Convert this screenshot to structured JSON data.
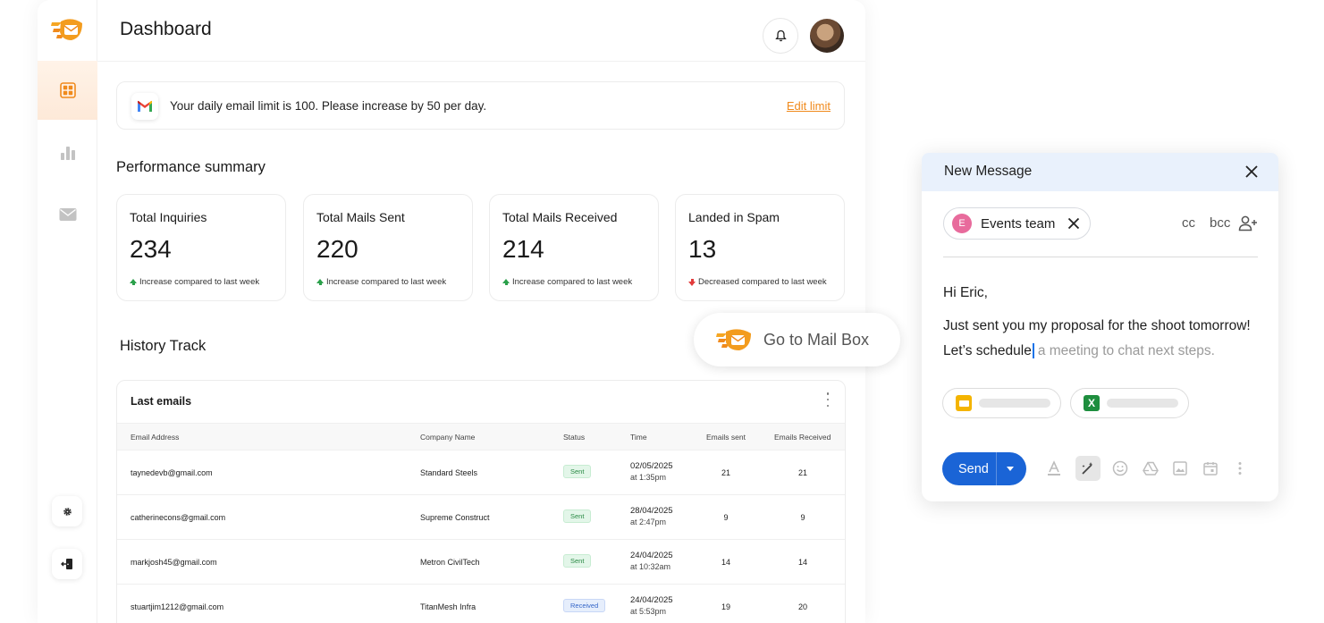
{
  "topbar": {
    "title": "Dashboard"
  },
  "sidebar": {
    "items": [
      {
        "name": "dashboard",
        "icon": "grid-icon",
        "active": true
      },
      {
        "name": "analytics",
        "icon": "bar-chart-icon",
        "active": false
      },
      {
        "name": "mail",
        "icon": "mail-icon",
        "active": false
      }
    ],
    "bottom": [
      {
        "name": "settings",
        "icon": "gear-icon"
      },
      {
        "name": "logout",
        "icon": "logout-icon"
      }
    ]
  },
  "limit": {
    "message": "Your daily email limit is 100. Please increase by 50 per day.",
    "edit_label": "Edit limit"
  },
  "summary": {
    "title": "Performance summary",
    "cards": [
      {
        "label": "Total Inquiries",
        "value": "234",
        "note": "Increase compared to last week",
        "trend": "up"
      },
      {
        "label": "Total Mails Sent",
        "value": "220",
        "note": "Increase compared to last week",
        "trend": "up"
      },
      {
        "label": "Total Mails Received",
        "value": "214",
        "note": "Increase compared to last week",
        "trend": "up"
      },
      {
        "label": "Landed in Spam",
        "value": "13",
        "note": "Decreased compared to last week",
        "trend": "down"
      }
    ]
  },
  "history": {
    "title": "History Track",
    "table_title": "Last emails",
    "columns": [
      "Email Address",
      "Company Name",
      "Status",
      "Time",
      "Emails sent",
      "Emails Received"
    ],
    "rows": [
      {
        "email": "taynedevb@gmail.com",
        "company": "Standard Steels",
        "status": "Sent",
        "date": "02/05/2025",
        "time": "at 1:35pm",
        "sent": "21",
        "received": "21"
      },
      {
        "email": "catherinecons@gmail.com",
        "company": "Supreme Construct",
        "status": "Sent",
        "date": "28/04/2025",
        "time": "at 2:47pm",
        "sent": "9",
        "received": "9"
      },
      {
        "email": "markjosh45@gmail.com",
        "company": "Metron CivilTech",
        "status": "Sent",
        "date": "24/04/2025",
        "time": "at 10:32am",
        "sent": "14",
        "received": "14"
      },
      {
        "email": "stuartjim1212@gmail.com",
        "company": "TitanMesh Infra",
        "status": "Received",
        "date": "24/04/2025",
        "time": "at 5:53pm",
        "sent": "19",
        "received": "20"
      }
    ]
  },
  "mailbox_button": {
    "label": "Go to Mail Box"
  },
  "composer": {
    "title": "New Message",
    "recipient": {
      "initial": "E",
      "name": "Events team"
    },
    "cc_label": "cc",
    "bcc_label": "bcc",
    "greeting": "Hi Eric,",
    "line1": "Just sent you my proposal for the shoot tomorrow!",
    "line2_typed": "Let’s schedule",
    "line2_suggestion": "a meeting to chat next steps.",
    "attachments": [
      {
        "type": "slides",
        "icon": "slides-icon",
        "color": "#f4b400"
      },
      {
        "type": "sheets",
        "icon": "excel-icon",
        "color": "#1e8e3e",
        "glyph": "X"
      }
    ],
    "send_label": "Send",
    "toolbar": [
      "text-format-icon",
      "magic-pen-icon",
      "emoji-icon",
      "drive-icon",
      "image-icon",
      "calendar-icon",
      "more-icon"
    ]
  },
  "colors": {
    "accent": "#f08a1c",
    "send_blue": "#1a64d6",
    "composer_header": "#e9f1fc",
    "trend_up": "#2aa04a",
    "trend_down": "#e23b3b"
  }
}
